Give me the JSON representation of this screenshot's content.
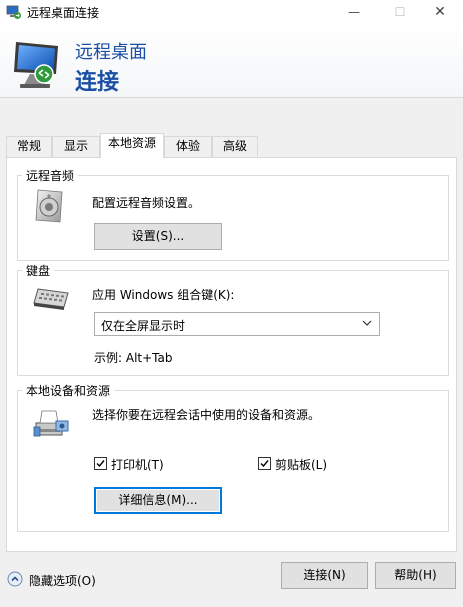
{
  "window": {
    "title": "远程桌面连接",
    "minimize_glyph": "—",
    "maximize_glyph": "☐",
    "close_glyph": "✕"
  },
  "banner": {
    "line1": "远程桌面",
    "line2": "连接"
  },
  "tabs": [
    {
      "label": "常规",
      "active": false
    },
    {
      "label": "显示",
      "active": false
    },
    {
      "label": "本地资源",
      "active": true
    },
    {
      "label": "体验",
      "active": false
    },
    {
      "label": "高级",
      "active": false
    }
  ],
  "audio": {
    "group_label": "远程音频",
    "description": "配置远程音频设置。",
    "settings_button": "设置(S)..."
  },
  "keyboard": {
    "group_label": "键盘",
    "description": "应用 Windows 组合键(K):",
    "selected_option": "仅在全屏显示时",
    "example": "示例: Alt+Tab"
  },
  "local_devices": {
    "group_label": "本地设备和资源",
    "description": "选择你要在远程会话中使用的设备和资源。",
    "printers_label": "打印机(T)",
    "printers_checked": true,
    "clipboard_label": "剪贴板(L)",
    "clipboard_checked": true,
    "details_button": "详细信息(M)..."
  },
  "footer": {
    "hide_options": "隐藏选项(O)",
    "connect_button": "连接(N)",
    "help_button": "帮助(H)"
  },
  "colors": {
    "banner_text": "#1b4fa3",
    "focus_border": "#0078d7",
    "button_face": "#e1e1e1"
  }
}
